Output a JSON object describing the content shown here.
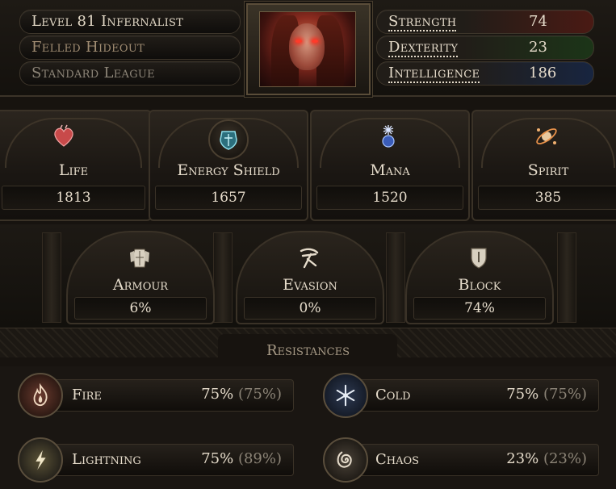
{
  "character": {
    "level_class": "Level 81 Infernalist",
    "area": "Felled Hideout",
    "league": "Standard League"
  },
  "attributes": [
    {
      "label": "Strength",
      "value": "74"
    },
    {
      "label": "Dexterity",
      "value": "23"
    },
    {
      "label": "Intelligence",
      "value": "186"
    }
  ],
  "pools": [
    {
      "label": "Life",
      "value": "1813",
      "icon": "heart-icon"
    },
    {
      "label": "Energy Shield",
      "value": "1657",
      "icon": "shield-icon"
    },
    {
      "label": "Mana",
      "value": "1520",
      "icon": "mana-icon"
    },
    {
      "label": "Spirit",
      "value": "385",
      "icon": "spirit-icon"
    }
  ],
  "defences": [
    {
      "label": "Armour",
      "value": "6%",
      "icon": "armour-icon"
    },
    {
      "label": "Evasion",
      "value": "0%",
      "icon": "evasion-icon"
    },
    {
      "label": "Block",
      "value": "74%",
      "icon": "block-icon"
    }
  ],
  "resistances": {
    "title": "Resistances",
    "items": [
      {
        "label": "Fire",
        "value": "75%",
        "max": "(75%)",
        "icon": "fire-icon"
      },
      {
        "label": "Cold",
        "value": "75%",
        "max": "(75%)",
        "icon": "cold-icon"
      },
      {
        "label": "Lightning",
        "value": "75%",
        "max": "(89%)",
        "icon": "lightning-icon"
      },
      {
        "label": "Chaos",
        "value": "23%",
        "max": "(23%)",
        "icon": "chaos-icon"
      }
    ]
  },
  "colors": {
    "strength": "#c44a3a",
    "dexterity": "#5f9b3a",
    "intelligence": "#4a6fb0"
  }
}
